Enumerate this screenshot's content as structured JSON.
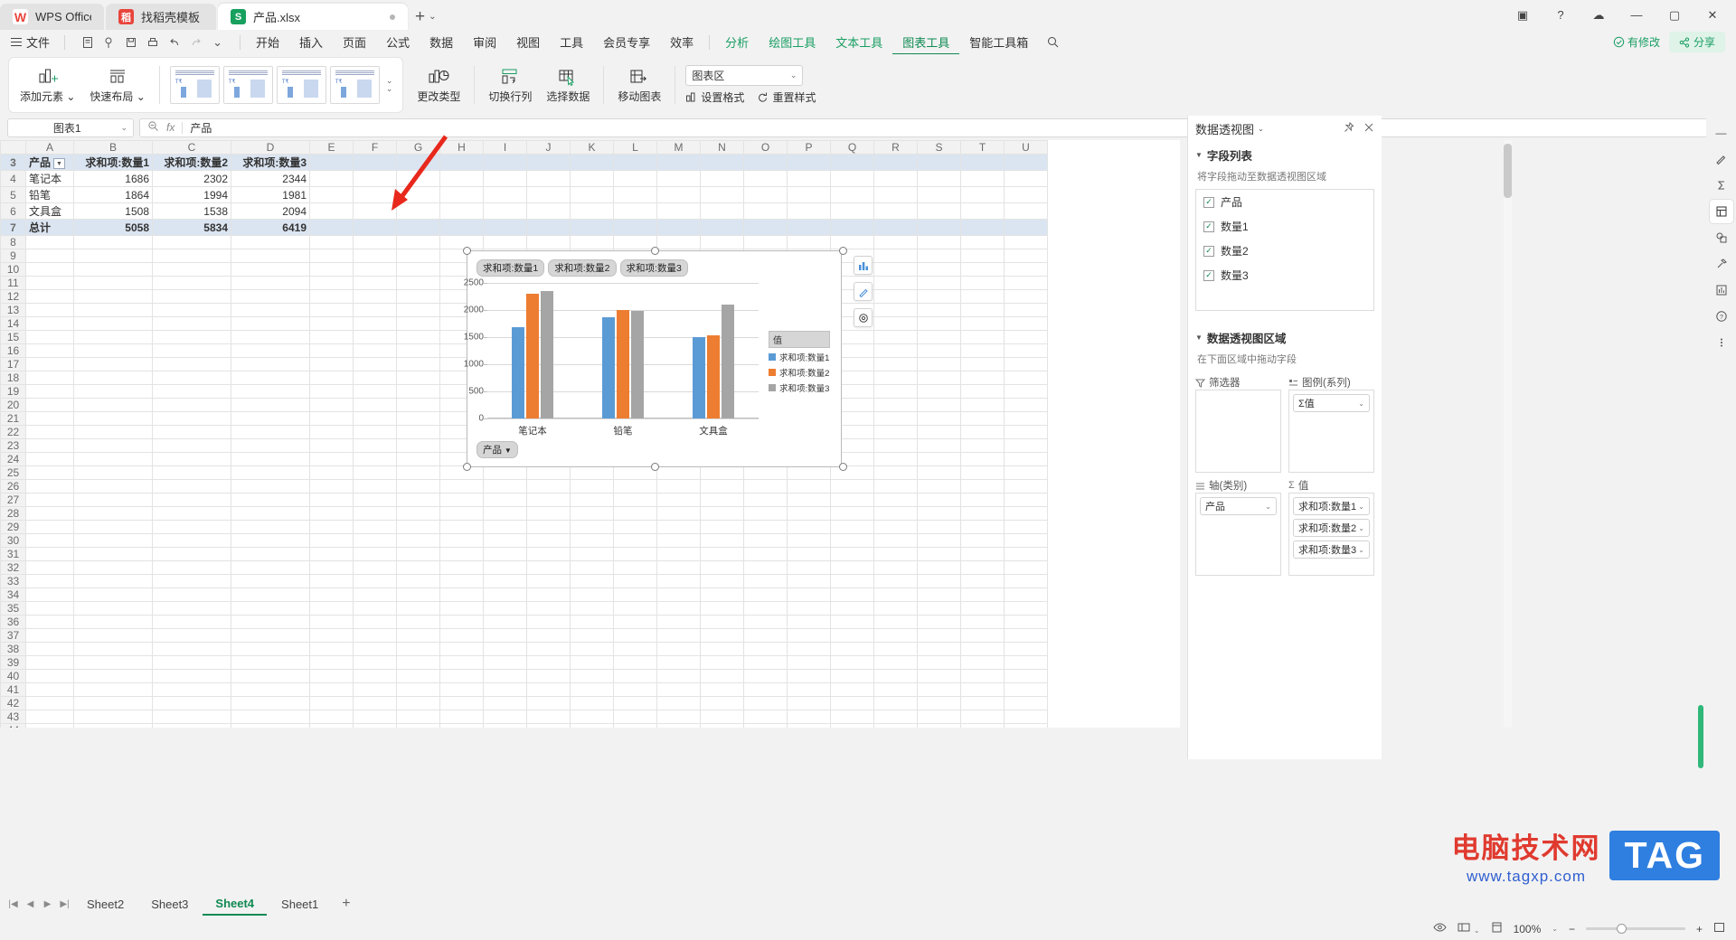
{
  "titlebar": {
    "tabs": [
      {
        "label": "WPS Office",
        "icon": "wps-logo-icon"
      },
      {
        "label": "找稻壳模板",
        "icon": "template-icon"
      },
      {
        "label": "产品.xlsx",
        "icon": "excel-icon"
      }
    ],
    "new_tab": "+",
    "tab_list_caret": "⌄",
    "window": {
      "panel": "▣",
      "minimize": "—",
      "maximize": "▢",
      "close": "✕",
      "cloud": "☁",
      "help": "?"
    }
  },
  "menubar": {
    "file": "文件",
    "quick_icons": [
      "new-icon",
      "open-icon",
      "save-icon",
      "print-icon",
      "undo-icon",
      "redo-icon",
      "more-icon"
    ],
    "items": [
      {
        "label": "开始",
        "style": "normal"
      },
      {
        "label": "插入",
        "style": "normal"
      },
      {
        "label": "页面",
        "style": "normal"
      },
      {
        "label": "公式",
        "style": "normal"
      },
      {
        "label": "数据",
        "style": "normal"
      },
      {
        "label": "审阅",
        "style": "normal"
      },
      {
        "label": "视图",
        "style": "normal"
      },
      {
        "label": "工具",
        "style": "normal"
      },
      {
        "label": "会员专享",
        "style": "normal"
      },
      {
        "label": "效率",
        "style": "normal"
      },
      {
        "label": "分析",
        "style": "green"
      },
      {
        "label": "绘图工具",
        "style": "green"
      },
      {
        "label": "文本工具",
        "style": "green"
      },
      {
        "label": "图表工具",
        "style": "selected"
      },
      {
        "label": "智能工具箱",
        "style": "normal"
      }
    ],
    "search_icon": "search-icon",
    "modified": "有修改",
    "share": "分享"
  },
  "ribbon": {
    "add_element": "添加元素",
    "quick_layout": "快速布局",
    "gallery_count": 4,
    "change_type": "更改类型",
    "switch_row_col": "切换行列",
    "select_data": "选择数据",
    "move_chart": "移动图表",
    "area_combo": "图表区",
    "set_format": "设置格式",
    "reset_style": "重置样式"
  },
  "formulabar": {
    "namebox": "图表1",
    "zoom_icon": "zoom-icon",
    "fx": "fx",
    "value": "产品"
  },
  "grid": {
    "columns": [
      "A",
      "B",
      "C",
      "D",
      "E",
      "F",
      "G",
      "H",
      "I",
      "J",
      "K",
      "L",
      "M",
      "N",
      "O",
      "P",
      "Q",
      "R",
      "S",
      "T",
      "U"
    ],
    "first_row": 3,
    "last_row": 45,
    "rows": [
      {
        "r": 3,
        "type": "header",
        "cells": [
          "产品",
          "求和项:数量1",
          "求和项:数量2",
          "求和项:数量3"
        ]
      },
      {
        "r": 4,
        "type": "data",
        "cells": [
          "笔记本",
          "1686",
          "2302",
          "2344"
        ]
      },
      {
        "r": 5,
        "type": "data",
        "cells": [
          "铅笔",
          "1864",
          "1994",
          "1981"
        ]
      },
      {
        "r": 6,
        "type": "data",
        "cells": [
          "文具盒",
          "1508",
          "1538",
          "2094"
        ]
      },
      {
        "r": 7,
        "type": "total",
        "cells": [
          "总计",
          "5058",
          "5834",
          "6419"
        ]
      }
    ]
  },
  "chart_data": {
    "type": "bar",
    "title": "",
    "categories": [
      "笔记本",
      "铅笔",
      "文具盒"
    ],
    "series": [
      {
        "name": "求和项:数量1",
        "color": "#5b9bd5",
        "values": [
          1686,
          1864,
          1508
        ]
      },
      {
        "name": "求和项:数量2",
        "color": "#ed7d31",
        "values": [
          2302,
          1994,
          1538
        ]
      },
      {
        "name": "求和项:数量3",
        "color": "#a5a5a5",
        "values": [
          2344,
          1981,
          2094
        ]
      }
    ],
    "ylim": [
      0,
      2500
    ],
    "yticks": [
      0,
      500,
      1000,
      1500,
      2000,
      2500
    ],
    "ytick_labels": [
      "0",
      "500",
      "1000",
      "1500",
      "2000",
      "2500"
    ],
    "legend_title": "值",
    "legend_position": "right",
    "grid": true,
    "xlabel": "",
    "ylabel": "",
    "field_buttons": [
      "求和项:数量1",
      "求和项:数量2",
      "求和项:数量3"
    ],
    "axis_button": "产品"
  },
  "chart_side_tools": [
    "chart-elements-icon",
    "chart-style-icon",
    "chart-filter-icon"
  ],
  "sidebar": {
    "title": "数据透视图",
    "title_caret": "⌄",
    "pin_icon": "pin-icon",
    "close_icon": "close-icon",
    "field_section": "字段列表",
    "field_hint": "将字段拖动至数据透视图区域",
    "fields": [
      {
        "label": "产品",
        "checked": true
      },
      {
        "label": "数量1",
        "checked": true
      },
      {
        "label": "数量2",
        "checked": true
      },
      {
        "label": "数量3",
        "checked": true
      }
    ],
    "area_section": "数据透视图区域",
    "area_hint": "在下面区域中拖动字段",
    "zones": [
      {
        "label": "筛选器",
        "icon": "filter-icon",
        "items": []
      },
      {
        "label": "图例(系列)",
        "icon": "legend-icon",
        "items": [
          "Σ值"
        ]
      },
      {
        "label": "轴(类别)",
        "icon": "axis-icon",
        "items": [
          "产品"
        ]
      },
      {
        "label": "值",
        "icon": "sigma-icon",
        "items": [
          "求和项:数量1",
          "求和项:数量2",
          "求和项:数量3"
        ]
      }
    ]
  },
  "rail_icons": [
    "minimize-rail-icon",
    "format-icon",
    "pivot-icon",
    "shapes-icon",
    "tools-icon",
    "chart-rail-icon",
    "help-icon",
    "more-rail-icon"
  ],
  "sheettabs": {
    "nav": [
      "|◀",
      "◀",
      "▶",
      "▶|"
    ],
    "sheets": [
      {
        "label": "Sheet2",
        "active": false
      },
      {
        "label": "Sheet3",
        "active": false
      },
      {
        "label": "Sheet4",
        "active": true
      },
      {
        "label": "Sheet1",
        "active": false
      }
    ],
    "add": "+"
  },
  "statusbar": {
    "view_icon": "eye-icon",
    "layout_icon": "layout-icon",
    "page_icon": "page-icon",
    "zoom": "100%",
    "minus": "−",
    "plus": "+",
    "fit_icon": "fit-icon"
  },
  "watermark": {
    "line1": "电脑技术网",
    "line2": "www.tagxp.com",
    "tag": "TAG"
  }
}
